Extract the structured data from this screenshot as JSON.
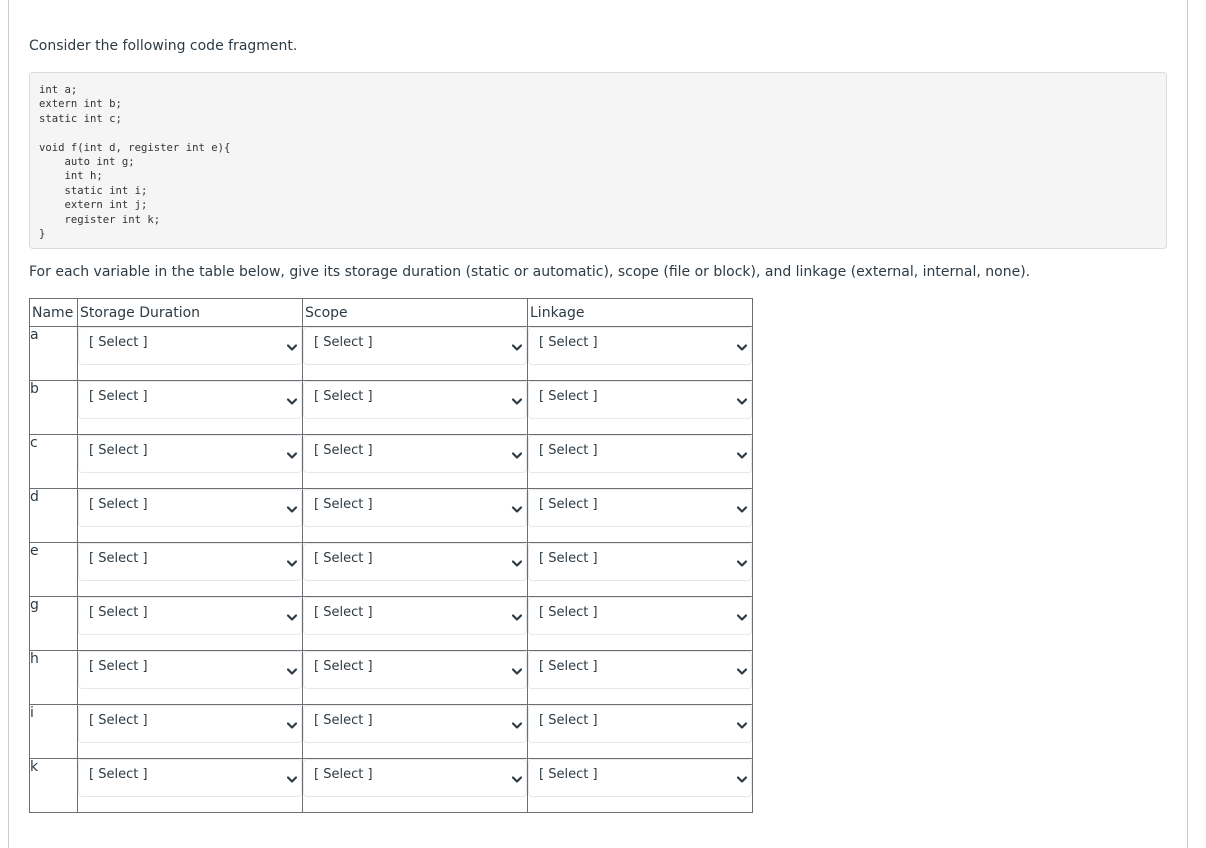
{
  "question": {
    "intro": "Consider the following code fragment.",
    "code": "int a;\nextern int b;\nstatic int c;\n\nvoid f(int d, register int e){\n    auto int g;\n    int h;\n    static int i;\n    extern int j;\n    register int k;\n}",
    "instructions": "For each variable in the table below, give its storage duration (static or automatic), scope (file or block), and linkage (external, internal, none)."
  },
  "table": {
    "headers": {
      "name": "Name",
      "storage_duration": "Storage Duration",
      "scope": "Scope",
      "linkage": "Linkage"
    },
    "rows": [
      {
        "name": "a",
        "storage_duration": "[ Select ]",
        "scope": "[ Select ]",
        "linkage": "[ Select ]"
      },
      {
        "name": "b",
        "storage_duration": "[ Select ]",
        "scope": "[ Select ]",
        "linkage": "[ Select ]"
      },
      {
        "name": "c",
        "storage_duration": "[ Select ]",
        "scope": "[ Select ]",
        "linkage": "[ Select ]"
      },
      {
        "name": "d",
        "storage_duration": "[ Select ]",
        "scope": "[ Select ]",
        "linkage": "[ Select ]"
      },
      {
        "name": "e",
        "storage_duration": "[ Select ]",
        "scope": "[ Select ]",
        "linkage": "[ Select ]"
      },
      {
        "name": "g",
        "storage_duration": "[ Select ]",
        "scope": "[ Select ]",
        "linkage": "[ Select ]"
      },
      {
        "name": "h",
        "storage_duration": "[ Select ]",
        "scope": "[ Select ]",
        "linkage": "[ Select ]"
      },
      {
        "name": "i",
        "storage_duration": "[ Select ]",
        "scope": "[ Select ]",
        "linkage": "[ Select ]"
      },
      {
        "name": "k",
        "storage_duration": "[ Select ]",
        "scope": "[ Select ]",
        "linkage": "[ Select ]"
      }
    ]
  },
  "icons": {
    "dropdown": "chevron-down-icon"
  },
  "colors": {
    "text": "#2d3b45",
    "code_background": "#f5f5f5",
    "table_border": "#6b6f73",
    "select_border": "#e6e8ea"
  }
}
